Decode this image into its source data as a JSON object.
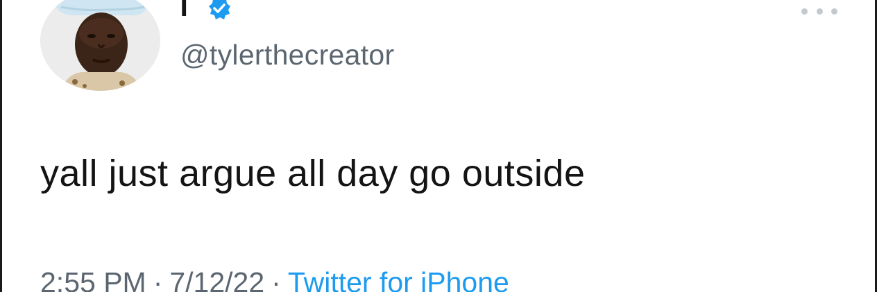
{
  "tweet": {
    "display_name": "T",
    "handle": "@tylerthecreator",
    "text": "yall just argue all day go outside",
    "time": "2:55 PM",
    "date": "7/12/22",
    "source": "Twitter for iPhone",
    "separator": "·"
  },
  "icons": {
    "verified": "verified-badge-icon",
    "more": "more-options-icon"
  },
  "colors": {
    "text": "#141414",
    "secondary": "#5b6670",
    "link": "#1d9bf0",
    "verified": "#1d9bf0"
  }
}
